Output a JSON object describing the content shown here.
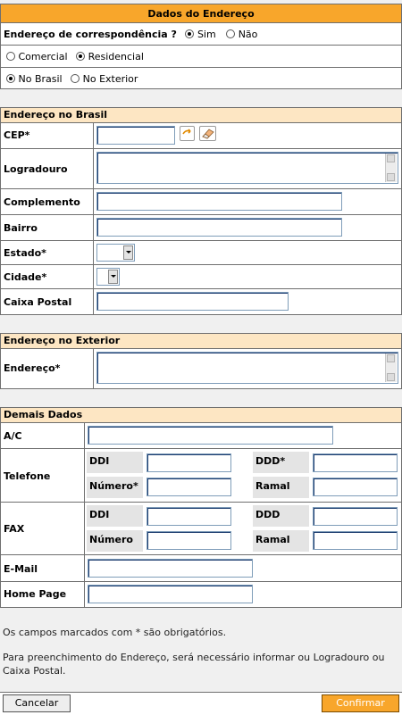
{
  "header": {
    "title": "Dados do Endereço"
  },
  "correspondence": {
    "question": "Endereço de correspondência ?",
    "options": [
      {
        "label": "Sim",
        "selected": true
      },
      {
        "label": "Não",
        "selected": false
      }
    ]
  },
  "address_type": [
    {
      "label": "Comercial",
      "selected": false
    },
    {
      "label": "Residencial",
      "selected": true
    }
  ],
  "location": [
    {
      "label": "No Brasil",
      "selected": true
    },
    {
      "label": "No Exterior",
      "selected": false
    }
  ],
  "brasil": {
    "heading": "Endereço no Brasil",
    "fields": {
      "cep": "CEP*",
      "logradouro": "Logradouro",
      "complemento": "Complemento",
      "bairro": "Bairro",
      "estado": "Estado*",
      "cidade": "Cidade*",
      "caixa_postal": "Caixa Postal"
    }
  },
  "exterior": {
    "heading": "Endereço no Exterior",
    "fields": {
      "endereco": "Endereço*"
    }
  },
  "demais": {
    "heading": "Demais Dados",
    "ac": "A/C",
    "telefone": {
      "label": "Telefone",
      "ddi": "DDI",
      "ddd": "DDD*",
      "numero": "Número*",
      "ramal": "Ramal"
    },
    "fax": {
      "label": "FAX",
      "ddi": "DDI",
      "ddd": "DDD",
      "numero": "Número",
      "ramal": "Ramal"
    },
    "email": "E-Mail",
    "homepage": "Home Page"
  },
  "notes": {
    "required": "Os campos marcados com * são obrigatórios.",
    "instruction_line1": "Para preenchimento do Endereço, será necessário informar ou Logradouro ou",
    "instruction_line2": "Caixa Postal."
  },
  "buttons": {
    "cancel": "Cancelar",
    "confirm": "Confirmar"
  },
  "colors": {
    "accent": "#f8a62b",
    "section_head": "#fde6c3"
  }
}
